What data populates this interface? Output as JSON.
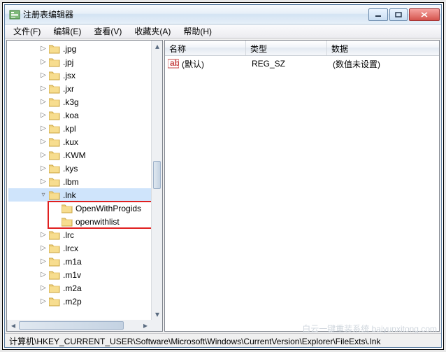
{
  "window": {
    "title": "注册表编辑器"
  },
  "menu": {
    "file": "文件(F)",
    "edit": "编辑(E)",
    "view": "查看(V)",
    "favorites": "收藏夹(A)",
    "help": "帮助(H)"
  },
  "tree": {
    "items": [
      {
        "depth": 2,
        "exp": "▷",
        "label": ".jpg"
      },
      {
        "depth": 2,
        "exp": "▷",
        "label": ".jpj"
      },
      {
        "depth": 2,
        "exp": "▷",
        "label": ".jsx"
      },
      {
        "depth": 2,
        "exp": "▷",
        "label": ".jxr"
      },
      {
        "depth": 2,
        "exp": "▷",
        "label": ".k3g"
      },
      {
        "depth": 2,
        "exp": "▷",
        "label": ".koa"
      },
      {
        "depth": 2,
        "exp": "▷",
        "label": ".kpl"
      },
      {
        "depth": 2,
        "exp": "▷",
        "label": ".kux"
      },
      {
        "depth": 2,
        "exp": "▷",
        "label": ".KWM"
      },
      {
        "depth": 2,
        "exp": "▷",
        "label": ".kys"
      },
      {
        "depth": 2,
        "exp": "▷",
        "label": ".lbm"
      },
      {
        "depth": 2,
        "exp": "▿",
        "label": ".lnk",
        "selected": true
      },
      {
        "depth": 3,
        "exp": "",
        "label": "OpenWithProgids",
        "hi": true
      },
      {
        "depth": 3,
        "exp": "",
        "label": "openwithlist",
        "hi": true
      },
      {
        "depth": 2,
        "exp": "▷",
        "label": ".lrc"
      },
      {
        "depth": 2,
        "exp": "▷",
        "label": ".lrcx"
      },
      {
        "depth": 2,
        "exp": "▷",
        "label": ".m1a"
      },
      {
        "depth": 2,
        "exp": "▷",
        "label": ".m1v"
      },
      {
        "depth": 2,
        "exp": "▷",
        "label": ".m2a"
      },
      {
        "depth": 2,
        "exp": "▷",
        "label": ".m2p"
      }
    ]
  },
  "list": {
    "headers": {
      "name": "名称",
      "type": "类型",
      "data": "数据"
    },
    "rows": [
      {
        "name": "(默认)",
        "type": "REG_SZ",
        "data": "(数值未设置)"
      }
    ]
  },
  "status": {
    "path": "计算机\\HKEY_CURRENT_USER\\Software\\Microsoft\\Windows\\CurrentVersion\\Explorer\\FileExts\\.lnk"
  },
  "watermark": "白云一键重装系统 baiyunxitong.com"
}
